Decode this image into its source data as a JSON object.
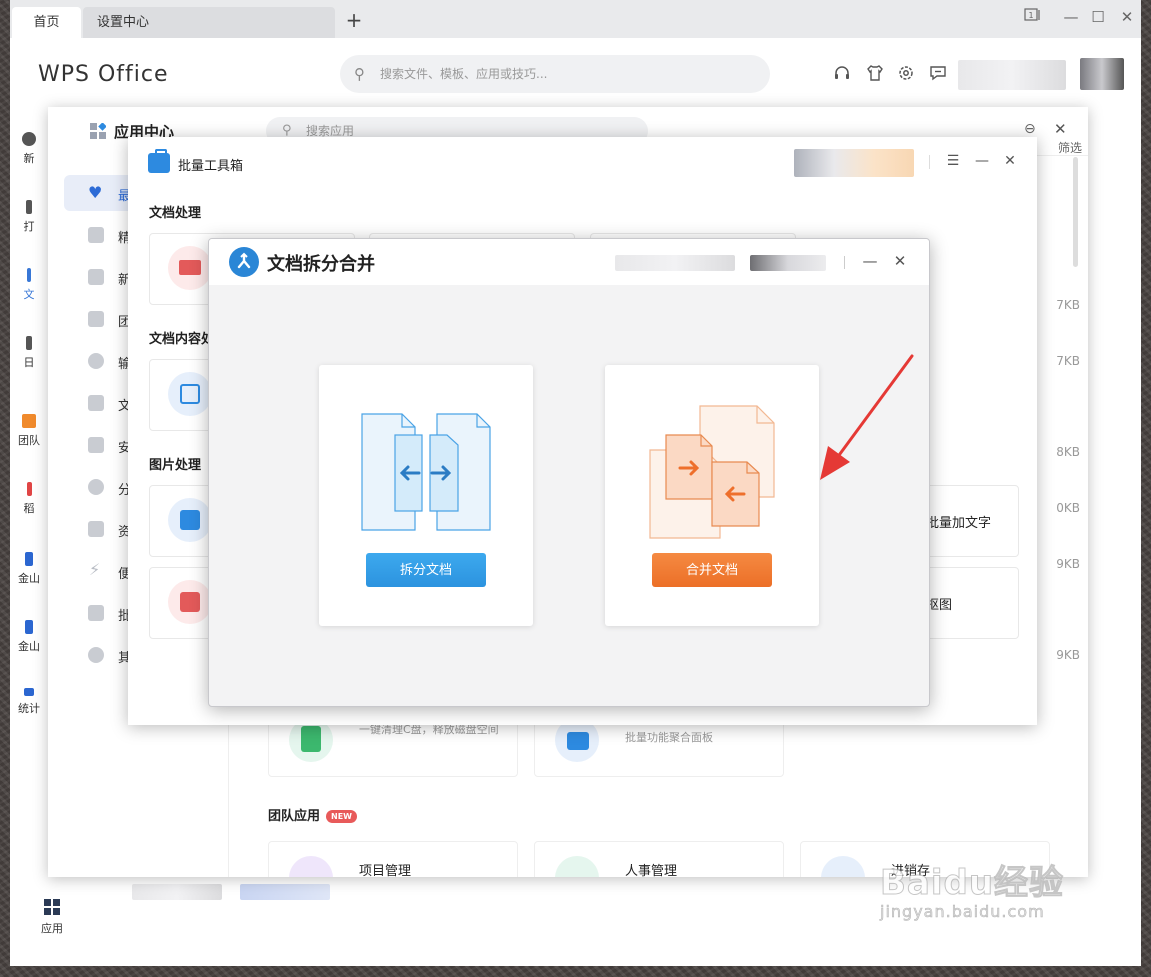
{
  "tabs": [
    {
      "label": "首页"
    },
    {
      "label": "设置中心"
    }
  ],
  "new_tab_symbol": "+",
  "window_controls": {
    "minimize": "—",
    "maximize": "☐",
    "close": "✕"
  },
  "header": {
    "logo": "WPS Office",
    "search_placeholder": "搜索文件、模板、应用或技巧..."
  },
  "left_rail": {
    "items": [
      {
        "label": "新"
      },
      {
        "label": "打"
      },
      {
        "label": "文"
      },
      {
        "label": "日"
      },
      {
        "label": "团队"
      },
      {
        "label": "稻"
      },
      {
        "label": "金山"
      },
      {
        "label": "金山"
      },
      {
        "label": "统计"
      }
    ],
    "apps_label": "应用"
  },
  "app_center": {
    "title": "应用中心",
    "search_placeholder": "搜索应用",
    "filter_label": "筛选",
    "sidebar": [
      {
        "label": "最",
        "active": true
      },
      {
        "label": "精"
      },
      {
        "label": "新"
      },
      {
        "label": "团"
      },
      {
        "label": "输"
      },
      {
        "label": "文"
      },
      {
        "label": "安"
      },
      {
        "label": "分"
      },
      {
        "label": "资"
      },
      {
        "label": "便"
      },
      {
        "label": "批"
      },
      {
        "label": "其"
      }
    ],
    "file_sizes": [
      "7KB",
      "7KB",
      "8KB",
      "0KB",
      "9KB",
      "9KB"
    ],
    "cards": [
      {
        "desc": "一键清理C盘，释放磁盘空间"
      },
      {
        "desc": "批量功能聚合面板"
      }
    ],
    "team_section": {
      "title": "团队应用",
      "badge": "NEW"
    },
    "team_apps": [
      {
        "title": "项目管理"
      },
      {
        "title": "人事管理"
      },
      {
        "title": "进销存"
      }
    ]
  },
  "toolbox": {
    "title": "批量工具箱",
    "sections": [
      {
        "title": "文档处理"
      },
      {
        "title": "文档内容处"
      },
      {
        "title": "图片处理"
      }
    ],
    "visible_tools": [
      {
        "label": "批量加文字"
      },
      {
        "label": "抠图"
      }
    ]
  },
  "dialog": {
    "title": "文档拆分合并",
    "split_button": "拆分文档",
    "merge_button": "合并文档"
  },
  "watermark": {
    "brand": "Baidu经验",
    "url": "jingyan.baidu.com"
  },
  "colors": {
    "accent_blue": "#2c93df",
    "accent_orange": "#ec6f27",
    "annotation_red": "#e53935"
  }
}
